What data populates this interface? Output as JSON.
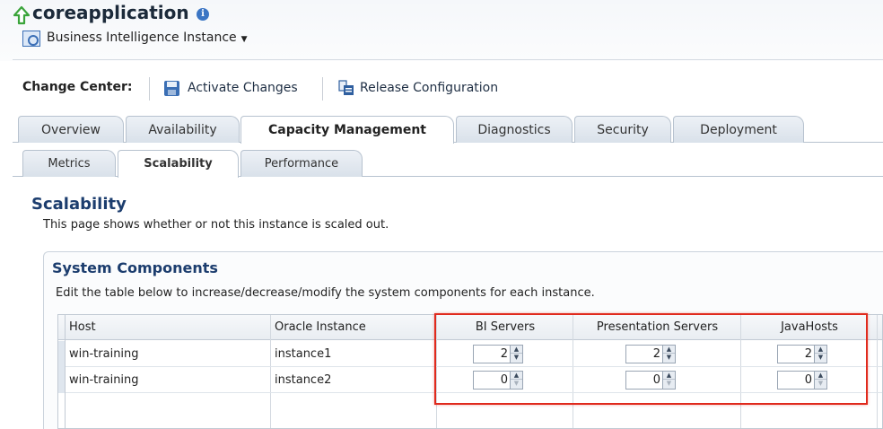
{
  "header": {
    "title": "coreapplication",
    "info_glyph": "i",
    "menu_label": "Business Intelligence Instance",
    "menu_caret": "▼"
  },
  "change_center": {
    "label": "Change Center:",
    "activate_label": "Activate Changes",
    "release_label": "Release Configuration"
  },
  "tabs": [
    {
      "label": "Overview",
      "active": false
    },
    {
      "label": "Availability",
      "active": false
    },
    {
      "label": "Capacity Management",
      "active": true
    },
    {
      "label": "Diagnostics",
      "active": false
    },
    {
      "label": "Security",
      "active": false
    },
    {
      "label": "Deployment",
      "active": false
    }
  ],
  "subtabs": [
    {
      "label": "Metrics",
      "active": false
    },
    {
      "label": "Scalability",
      "active": true
    },
    {
      "label": "Performance",
      "active": false
    }
  ],
  "page": {
    "title": "Scalability",
    "description": "This page shows whether or not this instance is scaled out."
  },
  "panel": {
    "title": "System Components",
    "description": "Edit the table below to increase/decrease/modify the system components for each instance."
  },
  "table": {
    "columns": [
      "Host",
      "Oracle Instance",
      "BI Servers",
      "Presentation Servers",
      "JavaHosts"
    ],
    "rows": [
      {
        "host": "win-training",
        "instance": "instance1",
        "bi_servers": "2",
        "presentation_servers": "2",
        "javahosts": "2"
      },
      {
        "host": "win-training",
        "instance": "instance2",
        "bi_servers": "0",
        "presentation_servers": "0",
        "javahosts": "0"
      }
    ]
  },
  "colors": {
    "accent": "#1c3d6e",
    "highlight": "#e02a1d",
    "up_arrow": "#3aa43a"
  },
  "icons": {
    "title": "up-arrow-icon",
    "info": "info-icon",
    "menu": "bi-instance-icon",
    "activate": "save-icon",
    "release": "release-config-icon"
  }
}
